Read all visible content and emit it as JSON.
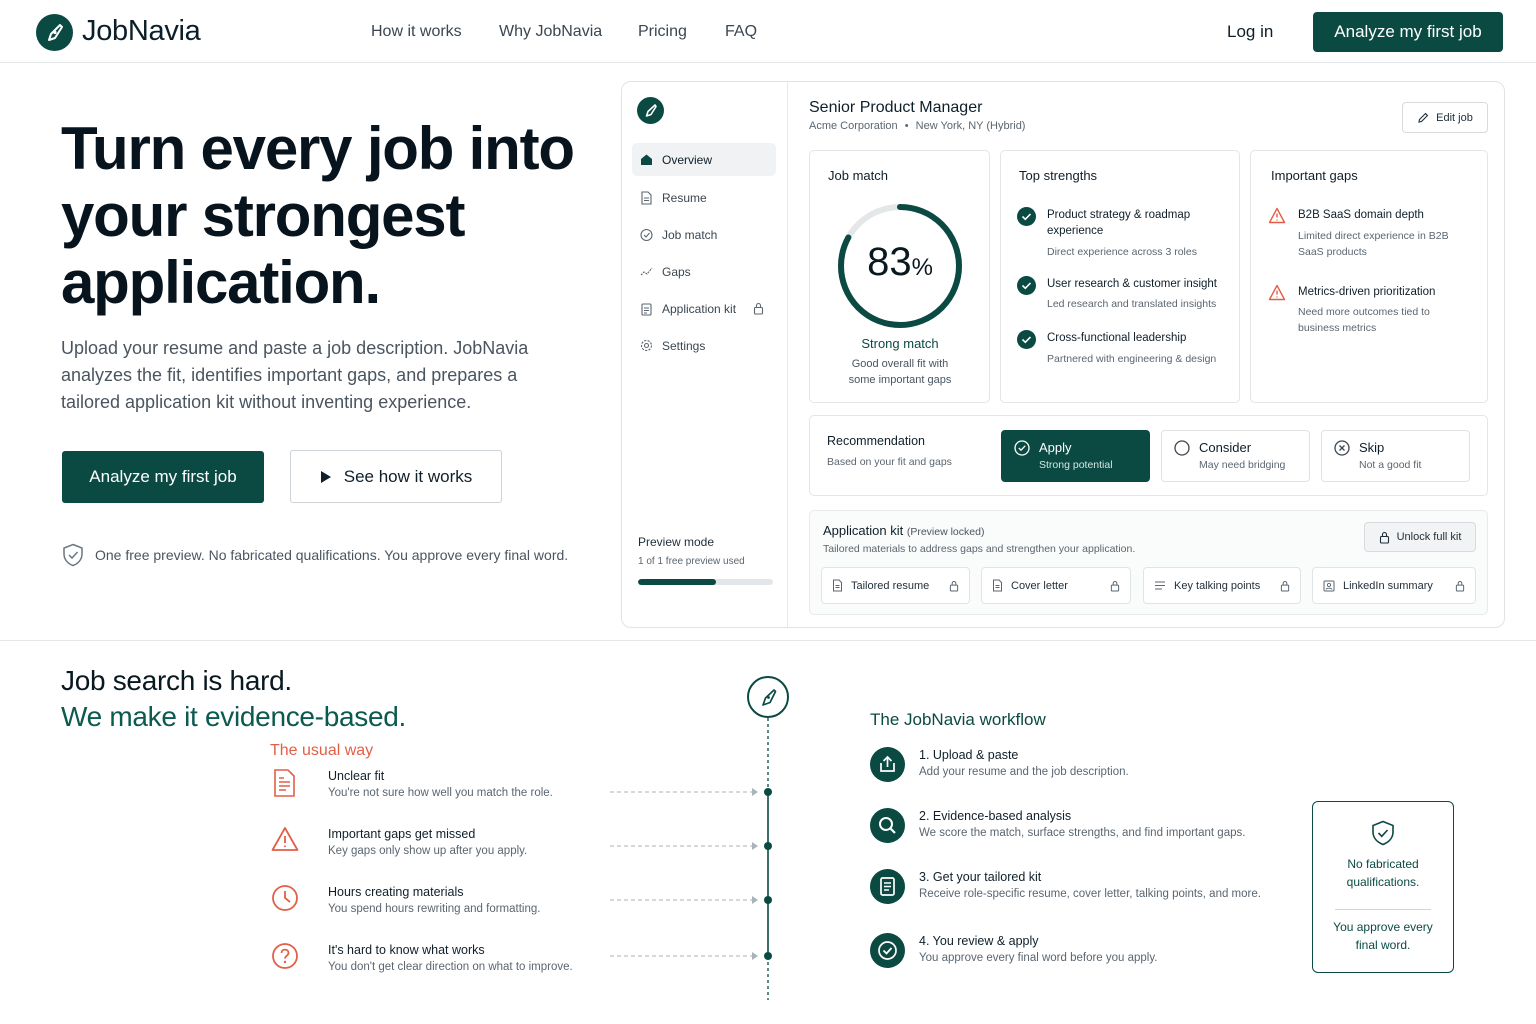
{
  "nav": {
    "brand": "JobNavia",
    "links": [
      "How it works",
      "Why JobNavia",
      "Pricing",
      "FAQ"
    ],
    "login": "Log in",
    "cta": "Analyze my first job"
  },
  "hero": {
    "title": "Turn every job into your strongest application.",
    "subtitle": "Upload your resume and paste a job description. JobNavia analyzes the fit, identifies important gaps, and prepares a tailored application kit without inventing experience.",
    "primary_cta": "Analyze my first job",
    "secondary_cta": "See how it works",
    "trust": "One free preview. No fabricated qualifications. You approve every final word."
  },
  "app": {
    "sidebar": {
      "items": [
        {
          "label": "Overview",
          "icon": "home-icon"
        },
        {
          "label": "Resume",
          "icon": "document-icon"
        },
        {
          "label": "Job match",
          "icon": "shield-check-icon"
        },
        {
          "label": "Gaps",
          "icon": "trend-icon"
        },
        {
          "label": "Application kit",
          "icon": "clipboard-icon"
        },
        {
          "label": "Settings",
          "icon": "gear-icon"
        }
      ],
      "preview_mode": "Preview mode",
      "preview_usage": "1 of 1 free preview used",
      "preview_progress": 0.58
    },
    "job": {
      "title": "Senior Product Manager",
      "company": "Acme Corporation",
      "separator": "•",
      "location": "New York, NY (Hybrid)",
      "edit": "Edit job"
    },
    "match": {
      "header": "Job match",
      "value": "83",
      "unit": "%",
      "percent": 83,
      "label": "Strong match",
      "desc": "Good overall fit with some important gaps"
    },
    "strengths": {
      "header": "Top strengths",
      "items": [
        {
          "title": "Product strategy & roadmap experience",
          "desc": "Direct experience across 3 roles"
        },
        {
          "title": "User research & customer insight",
          "desc": "Led research and translated insights"
        },
        {
          "title": "Cross-functional leadership",
          "desc": "Partnered with engineering & design"
        }
      ]
    },
    "gaps": {
      "header": "Important gaps",
      "items": [
        {
          "title": "B2B SaaS domain depth",
          "desc": "Limited direct experience in B2B SaaS products"
        },
        {
          "title": "Metrics-driven prioritization",
          "desc": "Need more outcomes tied to business metrics"
        }
      ]
    },
    "recommendation": {
      "header": "Recommendation",
      "sub": "Based on your fit and gaps",
      "options": [
        {
          "title": "Apply",
          "sub": "Strong potential"
        },
        {
          "title": "Consider",
          "sub": "May need bridging"
        },
        {
          "title": "Skip",
          "sub": "Not a good fit"
        }
      ]
    },
    "kit": {
      "header": "Application kit",
      "header_note": "(Preview locked)",
      "sub": "Tailored materials to address gaps and strengthen your application.",
      "unlock": "Unlock full kit",
      "items": [
        "Tailored resume",
        "Cover letter",
        "Key talking points",
        "LinkedIn summary"
      ]
    }
  },
  "section2": {
    "title_a": "Job search is hard.",
    "title_b": "We make it evidence-based.",
    "usual": "The usual way",
    "pains": [
      {
        "title": "Unclear fit",
        "desc": "You're not sure how well you match the role."
      },
      {
        "title": "Important gaps get missed",
        "desc": "Key gaps only show up after you apply."
      },
      {
        "title": "Hours creating materials",
        "desc": "You spend hours rewriting and formatting."
      },
      {
        "title": "It's hard to know what works",
        "desc": "You don't get clear direction on what to improve."
      }
    ],
    "workflow": {
      "header": "The JobNavia workflow",
      "steps": [
        {
          "title": "1. Upload & paste",
          "desc": "Add your resume and the job description."
        },
        {
          "title": "2. Evidence-based analysis",
          "desc": "We score the match, surface strengths, and find important gaps."
        },
        {
          "title": "3. Get your tailored kit",
          "desc": "Receive role-specific resume, cover letter, talking points, and more."
        },
        {
          "title": "4. You review & apply",
          "desc": "You approve every final word before you apply."
        }
      ]
    },
    "promise": {
      "line1": "No fabricated qualifications.",
      "line2": "You approve every final word."
    }
  },
  "colors": {
    "brand": "#0b4a43",
    "accent_warning": "#e25f47",
    "text": "#0f1f2a"
  }
}
